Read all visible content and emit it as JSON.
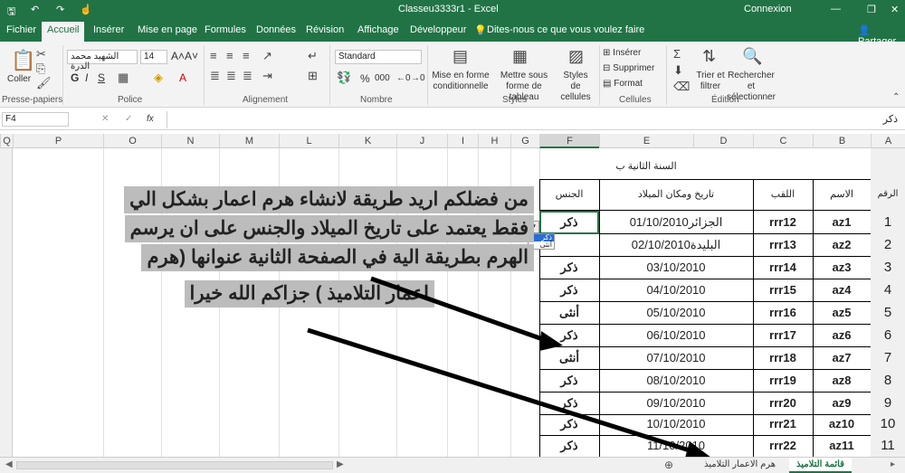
{
  "app": {
    "title": "Classeu3333r1  -  Excel",
    "account": "Connexion",
    "share": "Partager"
  },
  "tabs": [
    "Fichier",
    "Accueil",
    "Insérer",
    "Mise en page",
    "Formules",
    "Données",
    "Révision",
    "Affichage",
    "Développeur"
  ],
  "tell_me": "Dites-nous ce que vous voulez faire",
  "ribbon": {
    "paste": "Coller",
    "clipboard_group": "Presse-papiers",
    "font_name": "الشهيد محمد الدرة",
    "font_size": "14",
    "font_group": "Police",
    "align_group": "Alignement",
    "number_format": "Standard",
    "number_group": "Nombre",
    "percent": "%",
    "thousands": "000",
    "cond_format": "Mise en forme conditionnelle",
    "format_table": "Mettre sous forme de tableau",
    "cell_styles": "Styles de cellules",
    "styles_group": "Styles",
    "insert": "Insérer",
    "delete": "Supprimer",
    "format": "Format",
    "cells_group": "Cellules",
    "sort": "Trier et filtrer",
    "find": "Rechercher et sélectionner",
    "edit_group": "Édition",
    "bold": "G",
    "italic": "I",
    "underline": "S",
    "fx": "fx"
  },
  "formula_bar": {
    "name_box": "F4",
    "formula": "ذكر"
  },
  "columns": [
    "Q",
    "P",
    "O",
    "N",
    "M",
    "L",
    "K",
    "J",
    "I",
    "H",
    "G",
    "F",
    "E",
    "D",
    "C",
    "B",
    "A"
  ],
  "sheet": {
    "caption": "السنة الثانية ب",
    "headers": {
      "num": "الرقم",
      "name": "الاسم",
      "surname": "اللقب",
      "birth": "تاريخ ومكان الميلاد",
      "gender": "الجنس"
    },
    "rows": [
      {
        "num": "1",
        "name": "az1",
        "surname": "rrr12",
        "birth": "01/10/2010الجزائر",
        "gender": "ذكر"
      },
      {
        "num": "2",
        "name": "az2",
        "surname": "rrr13",
        "birth": "02/10/2010البليدة",
        "gender": ""
      },
      {
        "num": "3",
        "name": "az3",
        "surname": "rrr14",
        "birth": "03/10/2010",
        "gender": "ذكر"
      },
      {
        "num": "4",
        "name": "az4",
        "surname": "rrr15",
        "birth": "04/10/2010",
        "gender": "ذكر"
      },
      {
        "num": "5",
        "name": "az5",
        "surname": "rrr16",
        "birth": "05/10/2010",
        "gender": "أنثى"
      },
      {
        "num": "6",
        "name": "az6",
        "surname": "rrr17",
        "birth": "06/10/2010",
        "gender": "ذكر"
      },
      {
        "num": "7",
        "name": "az7",
        "surname": "rrr18",
        "birth": "07/10/2010",
        "gender": "أنثى"
      },
      {
        "num": "8",
        "name": "az8",
        "surname": "rrr19",
        "birth": "08/10/2010",
        "gender": "ذكر"
      },
      {
        "num": "9",
        "name": "az9",
        "surname": "rrr20",
        "birth": "09/10/2010",
        "gender": "ذكر"
      },
      {
        "num": "10",
        "name": "az10",
        "surname": "rrr21",
        "birth": "10/10/2010",
        "gender": "ذكر"
      },
      {
        "num": "11",
        "name": "az11",
        "surname": "rrr22",
        "birth": "11/10/2010",
        "gender": "ذكر"
      }
    ],
    "dropdown_options": [
      "ذكر",
      "أنثى"
    ]
  },
  "overlay_text": [
    "من فضلكم اريد طريقة لانشاء هرم اعمار بشكل الي",
    "فقط يعتمد على تاريخ الميلاد والجنس على ان يرسم",
    "الهرم بطريقة الية في الصفحة الثانية عنوانها (هرم",
    "اعمار التلاميذ ) جزاكم الله خيرا"
  ],
  "sheet_tabs": [
    "قائمة التلاميذ",
    "هرم الاعمار التلاميذ"
  ],
  "colors": {
    "excel_green": "#217346",
    "overlay_bg": "#bcbcbc"
  }
}
